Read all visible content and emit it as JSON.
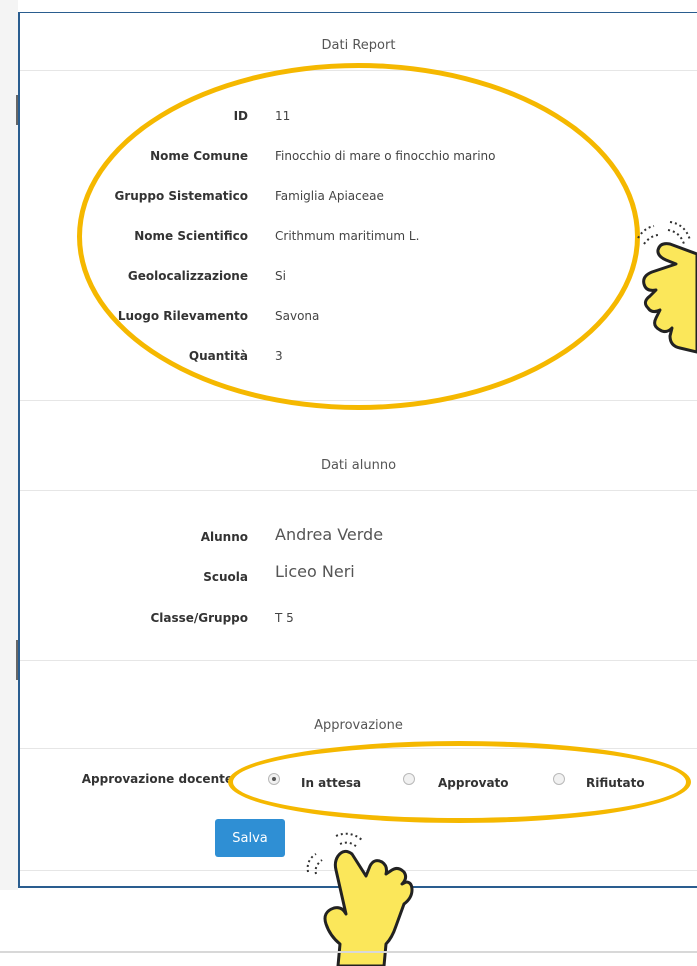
{
  "report": {
    "title": "Dati Report",
    "rows": [
      {
        "label": "ID",
        "value": "11"
      },
      {
        "label": "Nome Comune",
        "value": "Finocchio di mare o finocchio marino"
      },
      {
        "label": "Gruppo Sistematico",
        "value": "Famiglia Apiaceae"
      },
      {
        "label": "Nome Scientifico",
        "value": "Crithmum maritimum L."
      },
      {
        "label": "Geolocalizzazione",
        "value": "Si"
      },
      {
        "label": "Luogo Rilevamento",
        "value": "Savona"
      },
      {
        "label": "Quantità",
        "value": "3"
      }
    ]
  },
  "student": {
    "title": "Dati alunno",
    "rows": [
      {
        "label": "Alunno",
        "value": "Andrea Verde"
      },
      {
        "label": "Scuola",
        "value": "Liceo Neri"
      },
      {
        "label": "Classe/Gruppo",
        "value": "T 5"
      }
    ]
  },
  "approval": {
    "title": "Approvazione",
    "label": "Approvazione docente",
    "options": [
      {
        "label": "In attesa",
        "checked": true
      },
      {
        "label": "Approvato",
        "checked": false
      },
      {
        "label": "Rifiutato",
        "checked": false
      }
    ],
    "save_label": "Salva"
  },
  "colors": {
    "accent": "#2f8fd4",
    "highlight": "#f5b800",
    "frame": "#2a5d8f"
  },
  "icons": [
    "pointing-hand-icon",
    "pointing-hand-icon"
  ]
}
